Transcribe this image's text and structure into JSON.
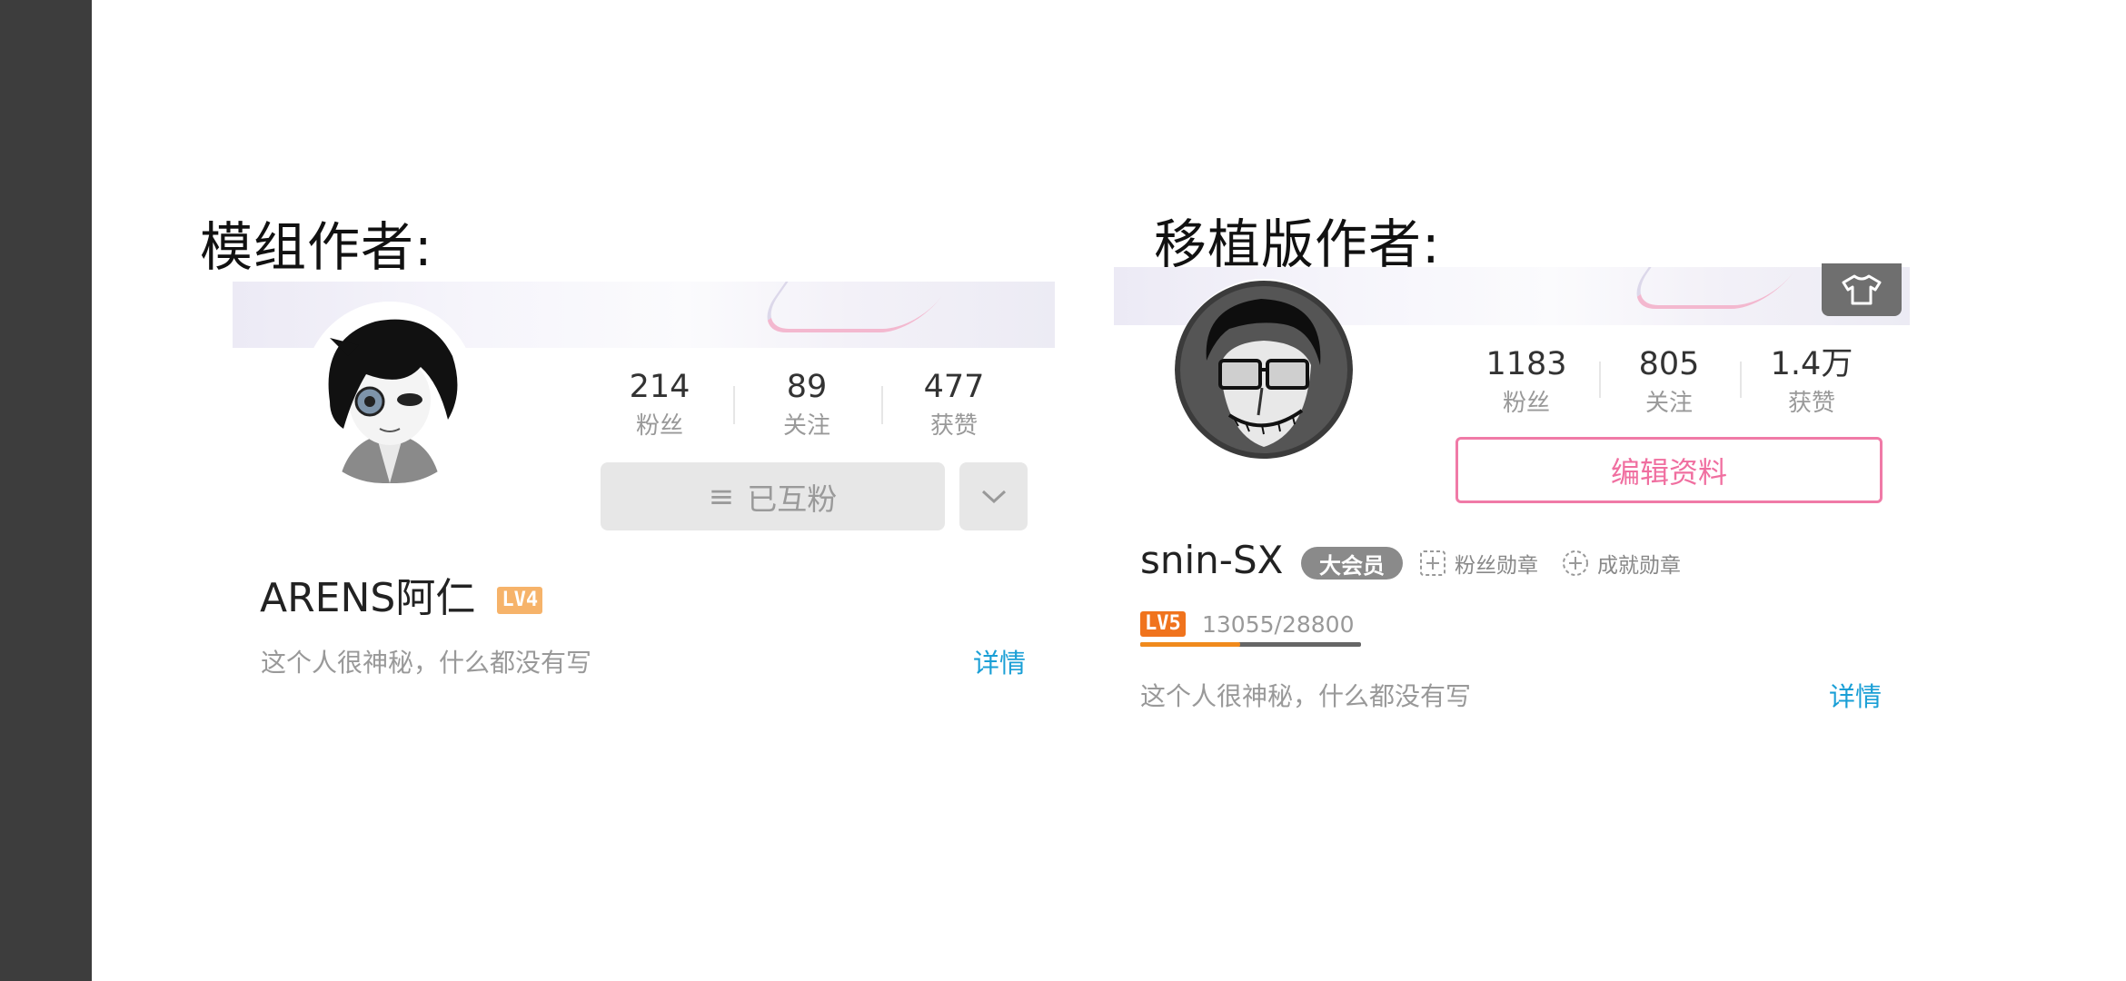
{
  "labels": {
    "left": "模组作者:",
    "right": "移植版作者:"
  },
  "left_profile": {
    "stats": [
      {
        "num": "214",
        "label": "粉丝"
      },
      {
        "num": "89",
        "label": "关注"
      },
      {
        "num": "477",
        "label": "获赞"
      }
    ],
    "follow_button": "已互粉",
    "name": "ARENS阿仁",
    "level": "LV4",
    "bio": "这个人很神秘，什么都没有写",
    "detail": "详情"
  },
  "right_profile": {
    "stats": [
      {
        "num": "1183",
        "label": "粉丝"
      },
      {
        "num": "805",
        "label": "关注"
      },
      {
        "num": "1.4万",
        "label": "获赞"
      }
    ],
    "edit_button": "编辑资料",
    "name": "snin-SX",
    "vip_badge": "大会员",
    "fan_medal": "粉丝勋章",
    "achievement_medal": "成就勋章",
    "level": "LV5",
    "exp_text": "13055/28800",
    "exp_progress": 0.453,
    "bio": "这个人很神秘，什么都没有写",
    "detail": "详情"
  },
  "colors": {
    "left_bar": "#3d3d3d",
    "detail_link": "#1a9fd6",
    "edit_accent": "#f06fa0",
    "lv4_badge": "#f6b36a",
    "lv5_badge": "#f0731d",
    "exp_fill": "#f08a1c"
  },
  "icons": [
    "menu-icon",
    "chevron-down-icon",
    "shirt-icon",
    "fan-medal-icon",
    "achievement-medal-icon"
  ]
}
